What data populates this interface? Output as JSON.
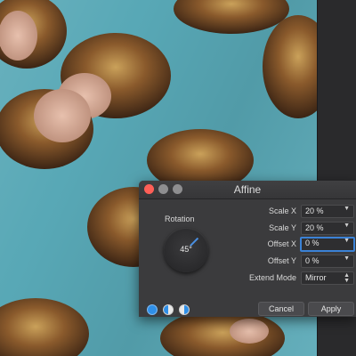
{
  "dialog": {
    "title": "Affine",
    "rotation": {
      "label": "Rotation",
      "value": "45°",
      "angle_degrees": 45
    },
    "scale_x": {
      "label": "Scale X",
      "value": "20 %"
    },
    "scale_y": {
      "label": "Scale Y",
      "value": "20 %"
    },
    "offset_x": {
      "label": "Offset X",
      "value": "0 %"
    },
    "offset_y": {
      "label": "Offset Y",
      "value": "0 %"
    },
    "extend_mode": {
      "label": "Extend Mode",
      "value": "Mirror"
    },
    "buttons": {
      "cancel": "Cancel",
      "apply": "Apply"
    }
  },
  "colors": {
    "accent": "#3b82d6",
    "close_button": "#ff5f57",
    "dialog_background": "#3b3b3d"
  },
  "icons": [
    "preview-mode-full-icon",
    "preview-mode-split-icon",
    "preview-mode-compare-icon"
  ]
}
